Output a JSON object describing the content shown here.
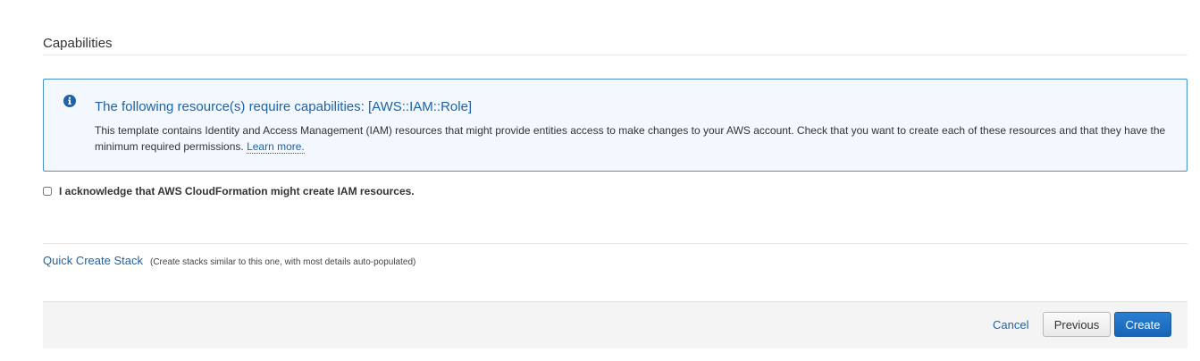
{
  "capabilities": {
    "section_title": "Capabilities"
  },
  "info_box": {
    "icon": "info-circle-icon",
    "title": "The following resource(s) require capabilities: [AWS::IAM::Role]",
    "body": "This template contains Identity and Access Management (IAM) resources that might provide entities access to make changes to your AWS account. Check that you want to create each of these resources and that they have the minimum required permissions.",
    "learn_more_label": "Learn more."
  },
  "acknowledge": {
    "checked": false,
    "label": "I acknowledge that AWS CloudFormation might create IAM resources."
  },
  "quick_create": {
    "link_label": "Quick Create Stack",
    "description": "(Create stacks similar to this one, with most details auto-populated)"
  },
  "footer": {
    "cancel_label": "Cancel",
    "previous_label": "Previous",
    "create_label": "Create"
  },
  "colors": {
    "accent": "#1e62a8",
    "primary_button": "#1a6ec2",
    "info_background": "#f2f8fd",
    "info_border": "#4a90c8"
  }
}
